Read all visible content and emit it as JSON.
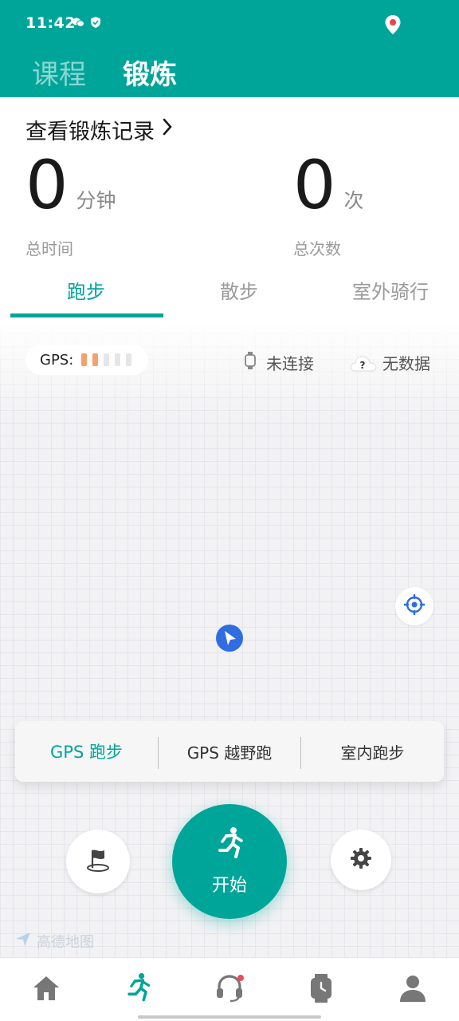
{
  "status_bar": {
    "time": "11:42"
  },
  "top_tabs": [
    {
      "label": "课程",
      "active": false
    },
    {
      "label": "锻炼",
      "active": true
    }
  ],
  "records_link": {
    "label": "查看锻炼记录"
  },
  "stats": {
    "total_time": {
      "value": "0",
      "unit": "分钟",
      "label": "总时间"
    },
    "total_count": {
      "value": "0",
      "unit": "次",
      "label": "总次数"
    }
  },
  "sport_tabs": [
    {
      "label": "跑步",
      "active": true
    },
    {
      "label": "散步",
      "active": false
    },
    {
      "label": "室外骑行",
      "active": false
    }
  ],
  "gps": {
    "label": "GPS:",
    "signal_bars_on": 2,
    "signal_bars_total": 5
  },
  "device": {
    "watch_status": "未连接",
    "weather_status": "无数据",
    "weather_icon_char": "?"
  },
  "run_modes": [
    {
      "label": "GPS 跑步",
      "active": true
    },
    {
      "label": "GPS 越野跑",
      "active": false
    },
    {
      "label": "室内跑步",
      "active": false
    }
  ],
  "start_button": {
    "label": "开始"
  },
  "map_watermark": {
    "label": "高德地图"
  },
  "colors": {
    "accent": "#00a59a",
    "gps_bar_on": "#f2a26a",
    "nav_arrow": "#2f6de1",
    "notification_dot": "#f04a5a"
  },
  "bottom_nav": [
    {
      "icon": "home-icon",
      "active": false
    },
    {
      "icon": "running-icon",
      "active": true
    },
    {
      "icon": "headset-icon",
      "active": false,
      "badge": true
    },
    {
      "icon": "watch-icon",
      "active": false
    },
    {
      "icon": "profile-icon",
      "active": false
    }
  ]
}
